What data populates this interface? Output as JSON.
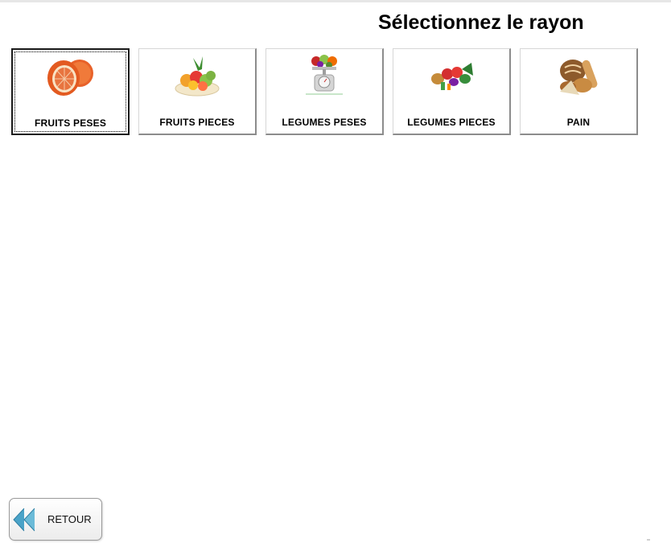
{
  "page": {
    "title": "Sélectionnez le rayon"
  },
  "departments": [
    {
      "label": "FRUITS PESES",
      "icon": "grapefruit-image",
      "selected": true
    },
    {
      "label": "FRUITS PIECES",
      "icon": "fruit-salad-image",
      "selected": false
    },
    {
      "label": "LEGUMES PESES",
      "icon": "vegetables-scale-image",
      "selected": false
    },
    {
      "label": "LEGUMES PIECES",
      "icon": "vegetables-image",
      "selected": false
    },
    {
      "label": "PAIN",
      "icon": "bread-image",
      "selected": false
    }
  ],
  "footer": {
    "back_label": "RETOUR",
    "back_icon": "double-arrow-left-icon"
  },
  "colors": {
    "selected_border": "#1a1a1a",
    "tile_shadow": "#8c8c8c",
    "back_arrow": "#4aa3c8"
  }
}
